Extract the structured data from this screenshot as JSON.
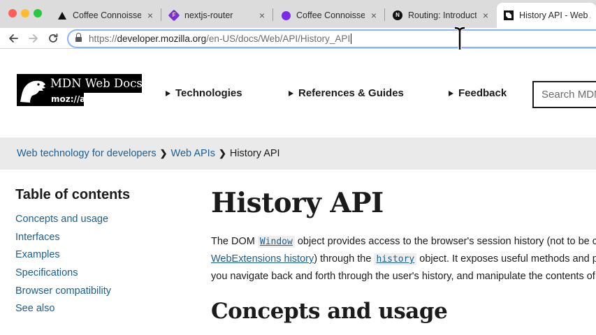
{
  "browser": {
    "tabs": [
      {
        "title": "Coffee Connoisseur",
        "icon": "vercel-triangle-icon"
      },
      {
        "title": "nextjs-router",
        "icon": "framer-icon"
      },
      {
        "title": "Coffee Connoisseur",
        "icon": "purple-circle-icon"
      },
      {
        "title": "Routing: Introduction",
        "icon": "nextjs-icon"
      },
      {
        "title": "History API - Web API",
        "icon": "mdn-icon"
      }
    ],
    "close_glyph": "×",
    "favicon_letters": {
      "framer": "F",
      "nextjs": "N"
    },
    "url": {
      "scheme": "https://",
      "host": "developer.mozilla.org",
      "path": "/en-US/docs/Web/API/History_API"
    }
  },
  "header": {
    "logo_title": "MDN Web Docs",
    "logo_sub": "moz://a",
    "nav": [
      "Technologies",
      "References & Guides",
      "Feedback"
    ],
    "search_placeholder": "Search MDN"
  },
  "breadcrumb": {
    "items": [
      "Web technology for developers",
      "Web APIs"
    ],
    "current": "History API",
    "separator": "❯"
  },
  "toc": {
    "title": "Table of contents",
    "items": [
      "Concepts and usage",
      "Interfaces",
      "Examples",
      "Specifications",
      "Browser compatibility",
      "See also"
    ]
  },
  "article": {
    "title": "History API",
    "p1": {
      "t1": "The DOM ",
      "code1": "Window",
      "t2": " object provides access to the browser's session history (not to be confused with",
      "link1": "WebExtensions history",
      "t3": ") through the ",
      "code2": "history",
      "t4": " object. It exposes useful methods and properties that let",
      "t5": "you navigate back and forth through the user's history, and manipulate the contents of the history stack."
    },
    "section1": "Concepts and usage"
  },
  "colors": {
    "link": "#1a5e94",
    "text": "#1b1b1b",
    "breadcrumb_bg": "#eaeaea",
    "tabbar_bg": "#dcdcdc",
    "url_focus": "#8ab4f8"
  }
}
